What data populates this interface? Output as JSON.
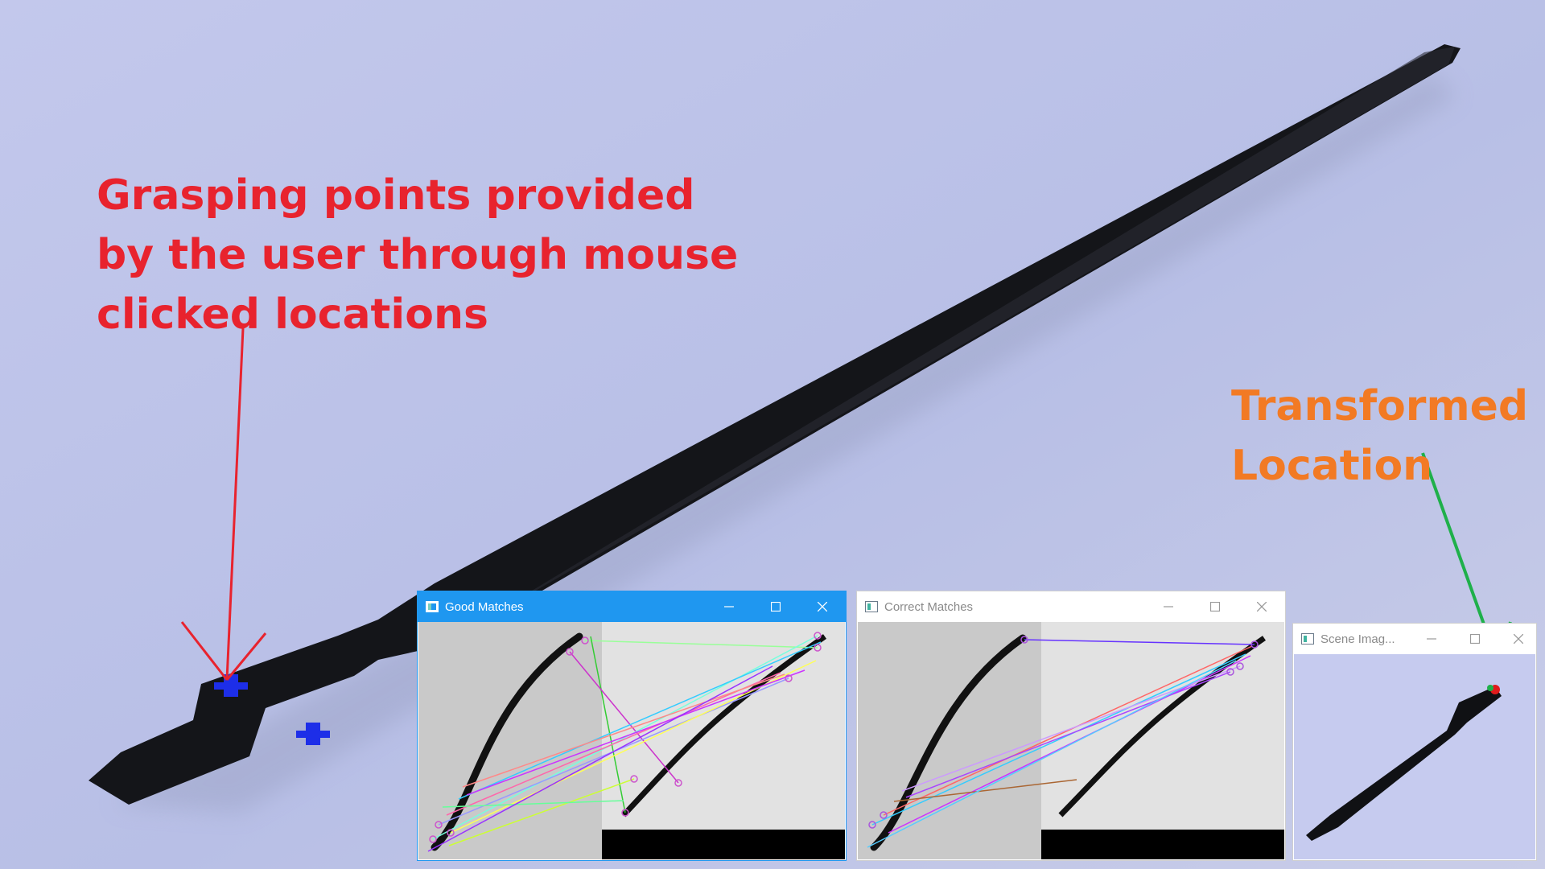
{
  "annotations": {
    "user_points": [
      "Grasping points provided",
      "by the user through mouse",
      "clicked locations"
    ],
    "transformed": [
      "Transformed",
      "Location"
    ]
  },
  "colors": {
    "user_text": "#e8232e",
    "transformed_text": "#f27a24",
    "active_titlebar": "#1f97f0",
    "grasp_marker": "#1d2ee8",
    "transformed_marker": "#e01b1b"
  },
  "windows": {
    "good_matches": {
      "title": "Good Matches",
      "state": "active"
    },
    "correct_matches": {
      "title": "Correct Matches",
      "state": "inactive"
    },
    "scene_image": {
      "title": "Scene Imag...",
      "state": "inactive"
    }
  },
  "window_controls": {
    "minimize_icon": "minimize-icon",
    "maximize_icon": "maximize-icon",
    "close_icon": "close-icon"
  }
}
